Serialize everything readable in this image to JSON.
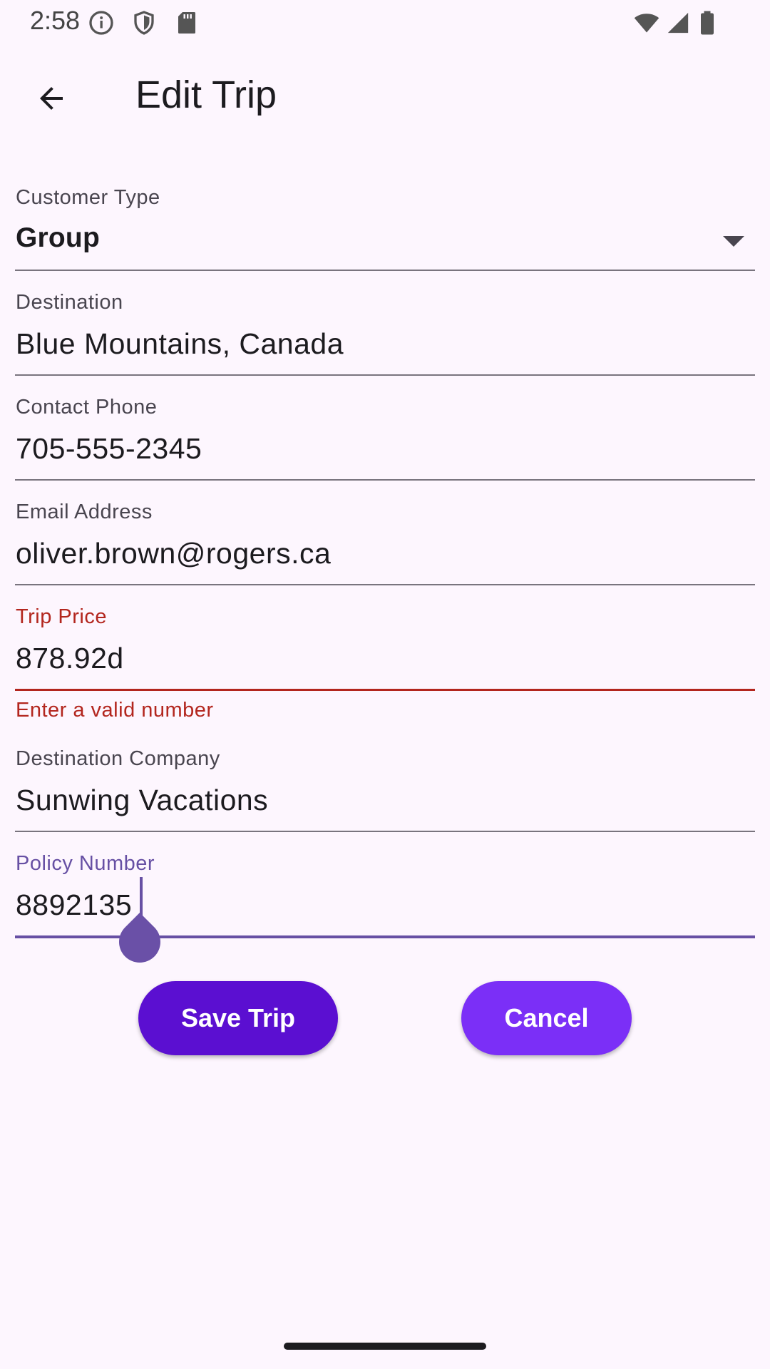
{
  "status_bar": {
    "time": "2:58",
    "left_icons": [
      "info-icon",
      "shield-icon",
      "sd-card-icon"
    ],
    "right_icons": [
      "wifi-icon",
      "signal-icon",
      "battery-icon"
    ]
  },
  "app_bar": {
    "title": "Edit Trip",
    "back_icon": "arrow-back-icon"
  },
  "form": {
    "customer_type": {
      "label": "Customer Type",
      "value": "Group"
    },
    "destination": {
      "label": "Destination",
      "value": "Blue Mountains, Canada"
    },
    "contact_phone": {
      "label": "Contact Phone",
      "value": "705-555-2345"
    },
    "email": {
      "label": "Email Address",
      "value": "oliver.brown@rogers.ca"
    },
    "trip_price": {
      "label": "Trip Price",
      "value": "878.92d",
      "error": "Enter a valid number"
    },
    "destination_company": {
      "label": "Destination Company",
      "value": "Sunwing Vacations"
    },
    "policy_number": {
      "label": "Policy Number",
      "value": "8892135"
    }
  },
  "buttons": {
    "save": "Save Trip",
    "cancel": "Cancel"
  },
  "colors": {
    "background": "#fdf6fe",
    "primary_focus": "#6750a4",
    "error": "#b3261e",
    "save_button": "#5b0fd1",
    "cancel_button": "#7b2ff7"
  }
}
